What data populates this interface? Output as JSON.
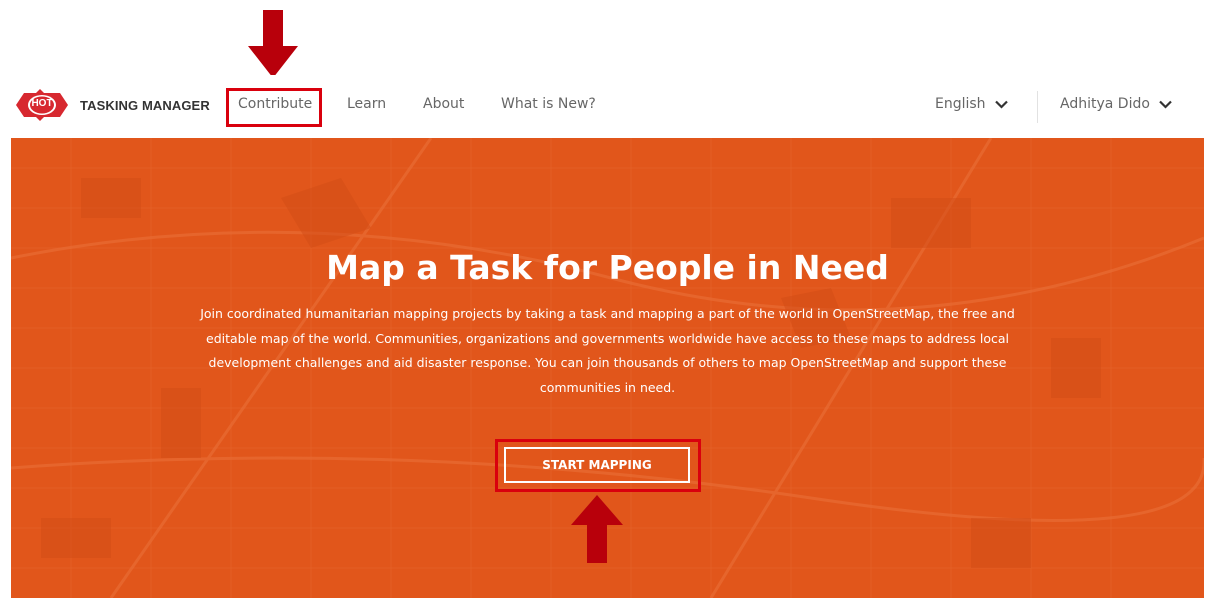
{
  "brand": {
    "badge": "HOT",
    "name": "TASKING MANAGER"
  },
  "nav": {
    "items": [
      {
        "label": "Contribute"
      },
      {
        "label": "Learn"
      },
      {
        "label": "About"
      },
      {
        "label": "What is New?"
      }
    ],
    "language": "English",
    "user": "Adhitya Dido"
  },
  "hero": {
    "title": "Map a Task for People in Need",
    "body": "Join coordinated humanitarian mapping projects by taking a task and mapping a part of the world in OpenStreetMap, the free and editable map of the world. Communities, organizations and governments worldwide have access to these maps to address local development challenges and aid disaster response. You can join thousands of others to map OpenStreetMap and support these communities in need.",
    "cta_label": "START MAPPING"
  },
  "colors": {
    "hero_bg": "#e1561b",
    "highlight": "#d9000d",
    "arrow": "#b8000b",
    "brand_red": "#d7282f"
  },
  "icons": [
    "hot-logo-icon",
    "chevron-down-icon",
    "arrow-down-icon",
    "arrow-up-icon"
  ]
}
